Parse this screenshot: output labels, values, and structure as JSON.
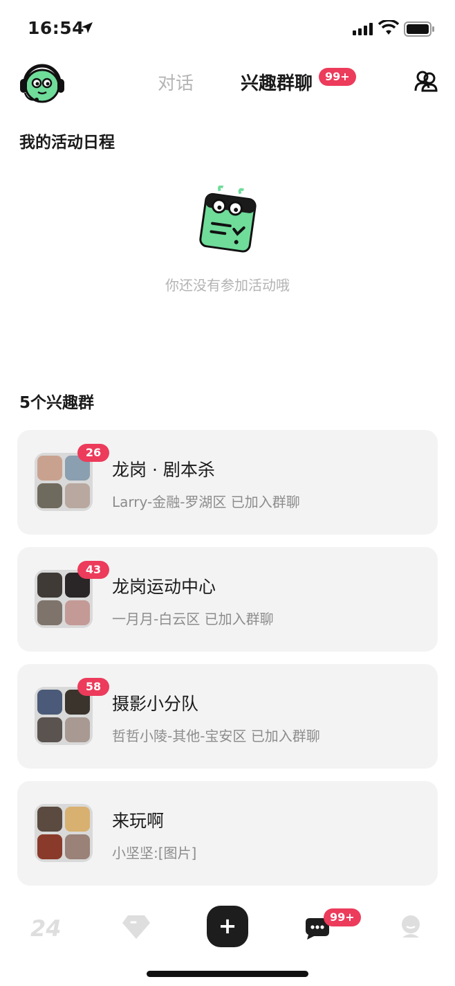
{
  "status": {
    "time": "16:54"
  },
  "header": {
    "tabs": [
      {
        "label": "对话"
      },
      {
        "label": "兴趣群聊",
        "badge": "99+"
      }
    ]
  },
  "activity": {
    "title": "我的活动日程",
    "empty_text": "你还没有参加活动哦"
  },
  "groups": {
    "title": "5个兴趣群",
    "items": [
      {
        "name": "龙岗 · 剧本杀",
        "subtitle": "Larry-金融-罗湖区 已加入群聊",
        "badge": "26",
        "avatars": [
          "#c9a28f",
          "#8a9fb0",
          "#6f6a5e",
          "#b8a8a0"
        ]
      },
      {
        "name": "龙岗运动中心",
        "subtitle": "一月月-白云区 已加入群聊",
        "badge": "43",
        "avatars": [
          "#3f3a36",
          "#2a2526",
          "#7e746b",
          "#c49a96"
        ]
      },
      {
        "name": "摄影小分队",
        "subtitle": "哲哲小陵-其他-宝安区 已加入群聊",
        "badge": "58",
        "avatars": [
          "#4a5a78",
          "#3a342c",
          "#5a5350",
          "#a89a92"
        ]
      },
      {
        "name": "来玩啊",
        "subtitle": "小坚坚:[图片]",
        "badge": "",
        "avatars": [
          "#5a4a40",
          "#d8b070",
          "#8a3a2a",
          "#9a8278"
        ]
      }
    ]
  },
  "nav": {
    "logo_text": "24",
    "add_label": "+",
    "chat_badge": "99+"
  },
  "colors": {
    "accent": "#ec3b5b",
    "mint": "#6fdc9a",
    "card_bg": "#f3f3f3"
  }
}
